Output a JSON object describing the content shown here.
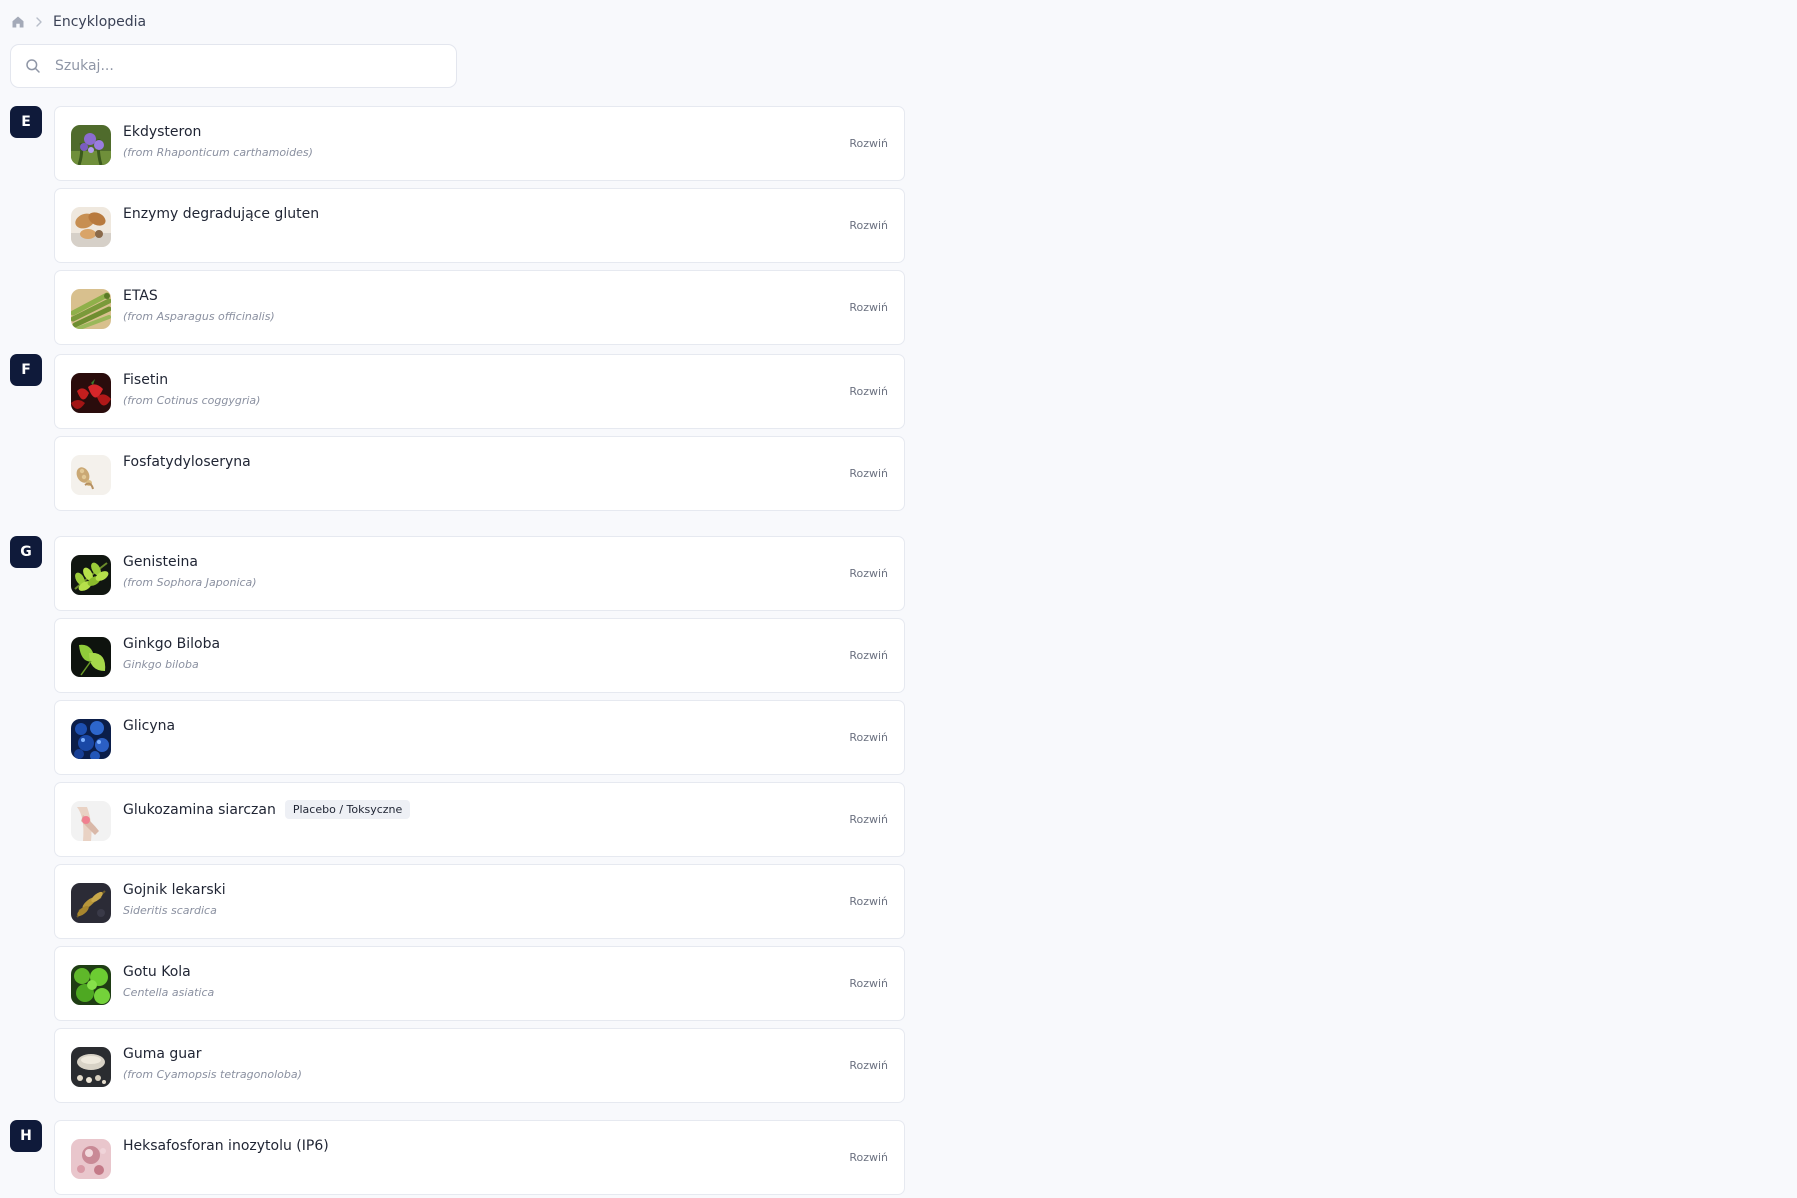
{
  "breadcrumb": {
    "home_icon": "home-icon",
    "current": "Encyklopedia"
  },
  "search": {
    "placeholder": "Szukaj..."
  },
  "colors": {
    "accent": "#0f1a3a",
    "page_bg": "#f8f9fc",
    "card_border": "#e6e9f0"
  },
  "expand_label": "Rozwiń",
  "sections": [
    {
      "letter": "E",
      "items": [
        {
          "title": "Ekdysteron",
          "subtitle": "(from Rhaponticum carthamoides)",
          "thumb": "purple-flower"
        },
        {
          "title": "Enzymy degradujące gluten",
          "subtitle": "",
          "thumb": "bread-crackers"
        },
        {
          "title": "ETAS",
          "subtitle": "(from Asparagus officinalis)",
          "thumb": "asparagus"
        }
      ]
    },
    {
      "letter": "F",
      "items": [
        {
          "title": "Fisetin",
          "subtitle": "(from Cotinus coggygria)",
          "thumb": "strawberries"
        },
        {
          "title": "Fosfatydyloseryna",
          "subtitle": "",
          "thumb": "soybeans"
        }
      ]
    },
    {
      "letter": "G",
      "items": [
        {
          "title": "Genisteina",
          "subtitle": "(from Sophora Japonica)",
          "thumb": "green-leaves"
        },
        {
          "title": "Ginkgo Biloba",
          "subtitle": "Ginkgo biloba",
          "thumb": "ginkgo-leaves"
        },
        {
          "title": "Glicyna",
          "subtitle": "",
          "thumb": "blue-crystals"
        },
        {
          "title": "Glukozamina siarczan",
          "subtitle": "",
          "thumb": "knee-joint",
          "badge": "Placebo / Toksyczne"
        },
        {
          "title": "Gojnik lekarski",
          "subtitle": "Sideritis scardica",
          "thumb": "herb-sprigs"
        },
        {
          "title": "Gotu Kola",
          "subtitle": "Centella asiatica",
          "thumb": "green-round-leaves"
        },
        {
          "title": "Guma guar",
          "subtitle": "(from Cyamopsis tetragonoloba)",
          "thumb": "guar-beans"
        }
      ]
    },
    {
      "letter": "H",
      "items": [
        {
          "title": "Heksafosforan inozytolu (IP6)",
          "subtitle": "",
          "thumb": "pink-grains"
        }
      ]
    }
  ]
}
